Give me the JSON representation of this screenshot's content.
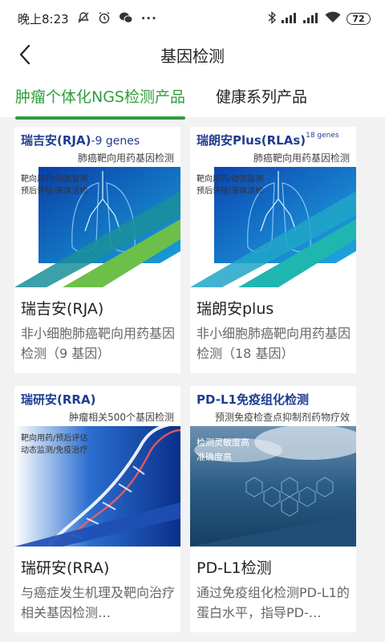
{
  "status": {
    "time": "晚上8:23",
    "battery": "72",
    "left_icons": [
      "mute-icon",
      "alarm-icon",
      "wechat-icon",
      "more-icon"
    ],
    "right_icons": [
      "bluetooth-icon",
      "signal-icon",
      "signal-icon",
      "wifi-icon"
    ]
  },
  "nav": {
    "title": "基因检测",
    "back_icon": "chevron-left-icon"
  },
  "tabs": [
    {
      "label": "肿瘤个体化NGS检测产品",
      "active": true
    },
    {
      "label": "健康系列产品",
      "active": false
    }
  ],
  "products": [
    {
      "banner_title": "瑞吉安(RJA)",
      "banner_suffix": "-9 genes",
      "banner_subtitle": "肺癌靶向用药基因检测",
      "banner_tags": [
        "靶向用药/动态监测",
        "预后评估/液体活检"
      ],
      "name": "瑞吉安(RJA)",
      "desc": "非小细胞肺癌靶向用药基因检测（9 基因）",
      "art": "lungs"
    },
    {
      "banner_title": "瑞朗安Plus(RLAs)",
      "banner_suffix": "18 genes",
      "banner_subtitle": "肺癌靶向用药基因检测",
      "banner_tags": [
        "靶向用药/动态监测",
        "预后评估/液体活检"
      ],
      "name": "瑞朗安plus",
      "desc": "非小细胞肺癌靶向用药基因检测（18 基因）",
      "art": "lungs"
    },
    {
      "banner_title": "瑞研安(RRA)",
      "banner_suffix": "",
      "banner_subtitle": "肿瘤相关500个基因检测",
      "banner_tags": [
        "靶向用药/预后评估",
        "动态监测/免疫治疗"
      ],
      "name": "瑞研安(RRA)",
      "desc": "与癌症发生机理及靶向治疗相关基因检测…",
      "art": "dna"
    },
    {
      "banner_title": "PD-L1免疫组化检测",
      "banner_suffix": "",
      "banner_subtitle": "预测免疫检查点抑制剂药物疗效",
      "banner_tags": [
        "检测灵敏度高",
        "准确度高"
      ],
      "name": "PD-L1检测",
      "desc": "通过免疫组化检测PD-L1的蛋白水平，指导PD-…",
      "art": "hex"
    }
  ]
}
